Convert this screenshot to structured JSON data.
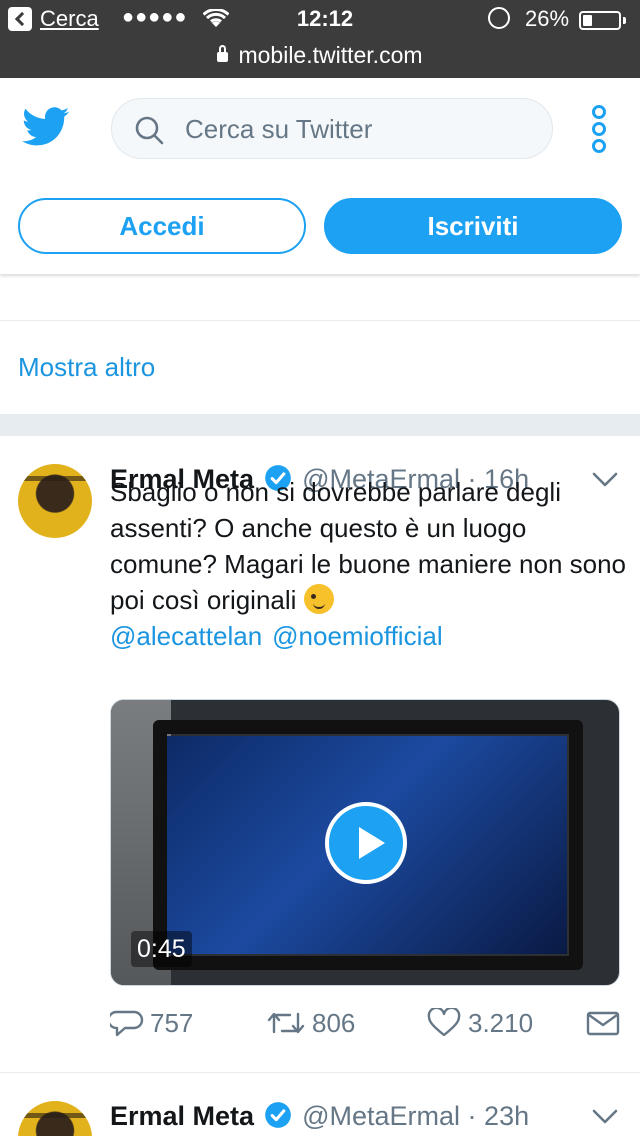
{
  "status_bar": {
    "back_label": "Cerca",
    "signal": "●●●●●",
    "time": "12:12",
    "battery_pct": "26%",
    "battery_level": 0.26,
    "url": "mobile.twitter.com"
  },
  "header": {
    "search_placeholder": "Cerca su Twitter",
    "login_label": "Accedi",
    "signup_label": "Iscriviti",
    "accent_color": "#1da1f2"
  },
  "timeline": {
    "show_more_label": "Mostra altro",
    "tweets": [
      {
        "name": "Ermal Meta",
        "handle": "@MetaErmal",
        "dot": "·",
        "time": "16h",
        "text": "Sbaglio o non si dovrebbe parlare degli assenti? O anche questo è un luogo comune? Magari le buone maniere non sono poi così originali",
        "mentions": [
          "@alecattelan",
          "@noemiofficial"
        ],
        "video_duration": "0:45",
        "replies": "757",
        "retweets": "806",
        "likes": "3.210"
      },
      {
        "name": "Ermal Meta",
        "handle": "@MetaErmal",
        "dot": "·",
        "time": "23h"
      }
    ]
  },
  "icons": {
    "twitter_bird": "twitter-bird-icon",
    "search": "search-icon",
    "more": "more-vertical-icon",
    "verified": "verified-badge-icon",
    "reply": "reply-icon",
    "retweet": "retweet-icon",
    "like": "heart-icon",
    "message": "envelope-icon"
  }
}
